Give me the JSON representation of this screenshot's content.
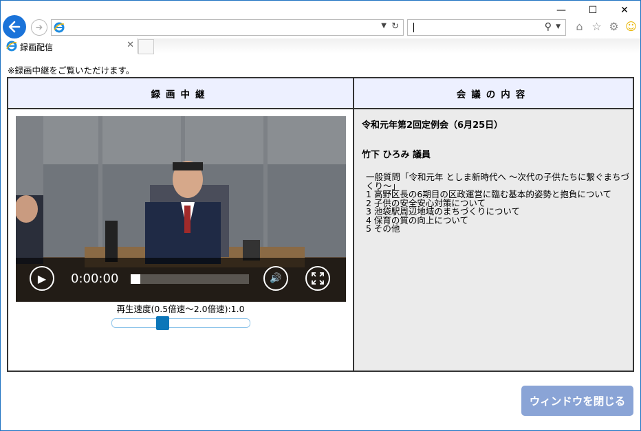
{
  "browser": {
    "address_value": "",
    "search_value": "",
    "tab_title": "録画配信",
    "window_controls": {
      "minimize": "—",
      "maximize": "☐",
      "close": "✕"
    }
  },
  "page": {
    "notice": "※録画中継をご覧いただけます。",
    "table": {
      "left_header": "録画中継",
      "right_header": "会議の内容"
    },
    "player": {
      "time": "0:00:00",
      "progress": 0,
      "speed_label": "再生速度(0.5倍速～2.0倍速):1.0",
      "speed_value": 1.0,
      "speed_min": 0.5,
      "speed_max": 2.0
    },
    "meeting": {
      "title": "令和元年第2回定例会（6月25日）",
      "speaker": "竹下 ひろみ 議員",
      "topics_heading": "一般質問「令和元年 としま新時代へ ～次代の子供たちに繋ぐまちづくり～」",
      "topics": [
        "1 高野区長の6期目の区政運営に臨む基本的姿勢と抱負について",
        "2 子供の安全安心対策について",
        "3 池袋駅周辺地域のまちづくりについて",
        "4 保育の質の向上について",
        "5 その他"
      ]
    },
    "close_button": "ウィンドウを閉じる"
  },
  "colors": {
    "header_bg": "#edf0ff",
    "content_bg": "#ebebeb",
    "close_button_bg": "#8aa4d6",
    "slider_thumb": "#0b76b9",
    "back_button": "#1a73d9"
  }
}
